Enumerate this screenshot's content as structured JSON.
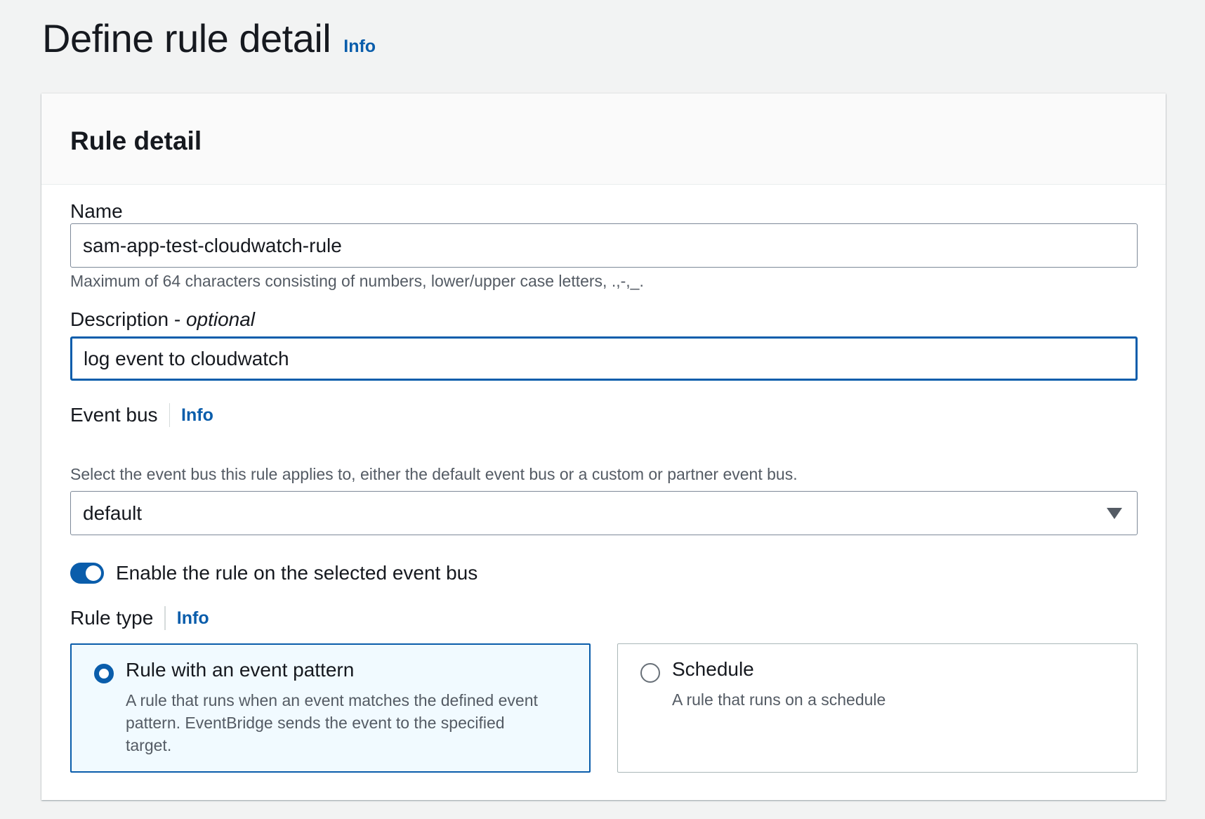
{
  "page": {
    "title": "Define rule detail",
    "info_label": "Info"
  },
  "panel": {
    "title": "Rule detail"
  },
  "name_field": {
    "label": "Name",
    "value": "sam-app-test-cloudwatch-rule",
    "hint": "Maximum of 64 characters consisting of numbers, lower/upper case letters, .,-,_."
  },
  "description_field": {
    "label": "Description - ",
    "label_optional": "optional",
    "value": "log event to cloudwatch"
  },
  "event_bus": {
    "label": "Event bus",
    "info_label": "Info",
    "hint": "Select the event bus this rule applies to, either the default event bus or a custom or partner event bus.",
    "selected": "default"
  },
  "enable_toggle": {
    "label": "Enable the rule on the selected event bus",
    "checked": true
  },
  "rule_type": {
    "label": "Rule type",
    "info_label": "Info",
    "options": [
      {
        "title": "Rule with an event pattern",
        "description": "A rule that runs when an event matches the defined event pattern. EventBridge sends the event to the specified target.",
        "selected": true
      },
      {
        "title": "Schedule",
        "description": "A rule that runs on a schedule",
        "selected": false
      }
    ]
  },
  "colors": {
    "accent": "#0a5dab",
    "background": "#f2f3f3",
    "text": "#16191f",
    "secondary_text": "#545b64",
    "selected_tile_bg": "#f1faff"
  }
}
